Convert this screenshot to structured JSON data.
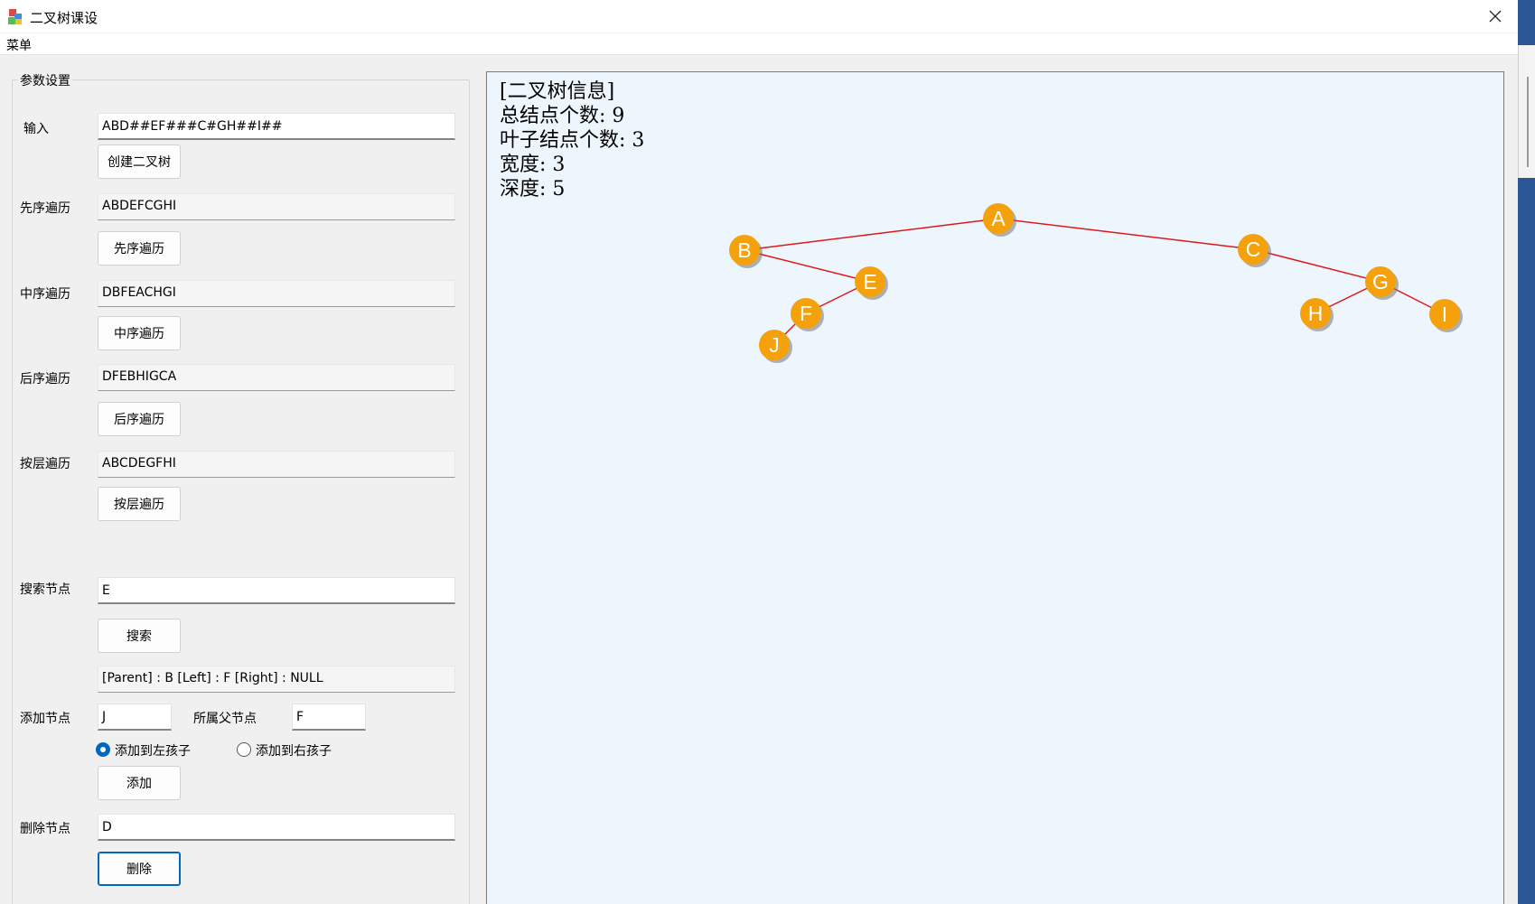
{
  "window": {
    "title": "二叉树课设"
  },
  "menubar": {
    "menu_label": "菜单"
  },
  "params": {
    "legend": "参数设置",
    "input": {
      "label": "输入",
      "value": "ABD##EF###C#GH##I##",
      "create_button": "创建二叉树"
    },
    "preorder": {
      "label": "先序遍历",
      "result": "ABDEFCGHI",
      "button": "先序遍历"
    },
    "inorder": {
      "label": "中序遍历",
      "result": "DBFEACHGI",
      "button": "中序遍历"
    },
    "postorder": {
      "label": "后序遍历",
      "result": "DFEBHIGCA",
      "button": "后序遍历"
    },
    "levelorder": {
      "label": "按层遍历",
      "result": "ABCDEGFHI",
      "button": "按层遍历"
    },
    "search": {
      "label": "搜索节点",
      "value": "E",
      "button": "搜索",
      "result": "[Parent] : B [Left] : F [Right] : NULL"
    },
    "add": {
      "label": "添加节点",
      "value": "J",
      "parent_label": "所属父节点",
      "parent_value": "F",
      "radio_left": "添加到左孩子",
      "radio_right": "添加到右孩子",
      "selected": "left",
      "button": "添加"
    },
    "delete": {
      "label": "删除节点",
      "value": "D",
      "button": "删除"
    }
  },
  "info": {
    "heading": "[二叉树信息]",
    "total_nodes": "总结点个数: 9",
    "leaf_nodes": "叶子结点个数: 3",
    "width": "宽度: 3",
    "depth": "深度: 5"
  },
  "tree": {
    "nodes": [
      "A",
      "B",
      "C",
      "E",
      "F",
      "J",
      "G",
      "H",
      "I"
    ],
    "edges": [
      [
        "A",
        "B"
      ],
      [
        "A",
        "C"
      ],
      [
        "B",
        "E"
      ],
      [
        "E",
        "F"
      ],
      [
        "F",
        "J"
      ],
      [
        "C",
        "G"
      ],
      [
        "G",
        "H"
      ],
      [
        "G",
        "I"
      ]
    ],
    "node_color": "#f5a10c",
    "edge_color": "#e01818"
  }
}
